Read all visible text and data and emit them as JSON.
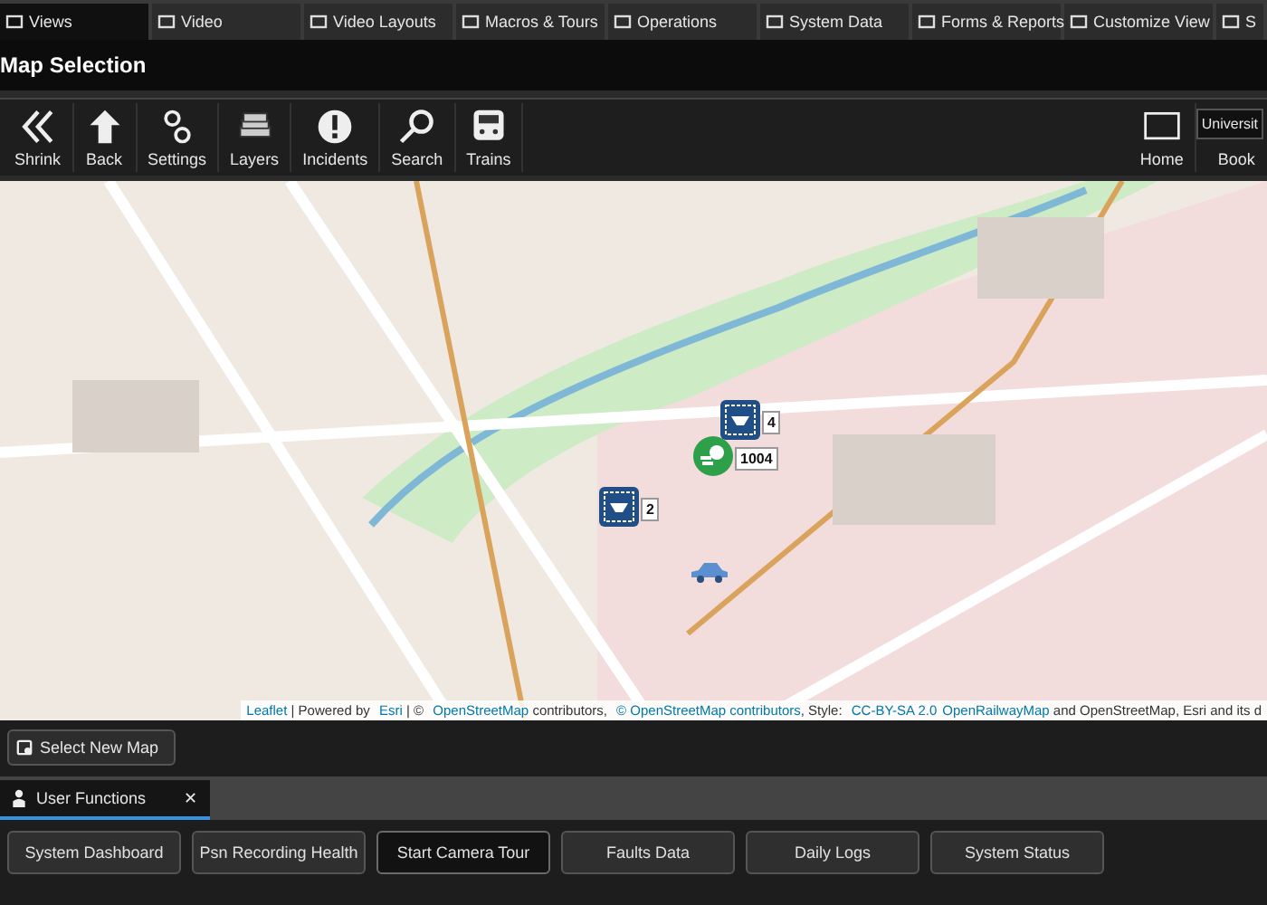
{
  "tabs": [
    {
      "label": "Views",
      "selected": true
    },
    {
      "label": "Video",
      "selected": false
    },
    {
      "label": "Video Layouts",
      "selected": false
    },
    {
      "label": "Macros & Tours",
      "selected": false
    },
    {
      "label": "Operations",
      "selected": false
    },
    {
      "label": "System Data",
      "selected": false
    },
    {
      "label": "Forms & Reports",
      "selected": false
    },
    {
      "label": "Customize View",
      "selected": false
    },
    {
      "label": "S",
      "selected": false
    }
  ],
  "title": "Map Selection",
  "toolbar": {
    "items": [
      "Shrink",
      "Back",
      "Settings",
      "Layers",
      "Incidents",
      "Search",
      "Trains"
    ],
    "home": "Home",
    "bookmark_field": {
      "value": "Universit"
    },
    "bookmark_label": "Book"
  },
  "map": {
    "markers": [
      {
        "kind": "camera",
        "label": "4"
      },
      {
        "kind": "group",
        "label": "1004"
      },
      {
        "kind": "camera",
        "label": "2"
      },
      {
        "kind": "vehicle"
      }
    ],
    "attribution": [
      {
        "kind": "link",
        "text": "Leaflet"
      },
      {
        "kind": "text",
        "text": " | Powered by "
      },
      {
        "kind": "link",
        "text": "Esri"
      },
      {
        "kind": "text",
        "text": " | © "
      },
      {
        "kind": "link",
        "text": "OpenStreetMap"
      },
      {
        "kind": "text",
        "text": " contributors, "
      },
      {
        "kind": "link",
        "text": "© OpenStreetMap contributors"
      },
      {
        "kind": "text",
        "text": ", Style: "
      },
      {
        "kind": "link",
        "text": "CC-BY-SA 2.0"
      },
      {
        "kind": "link",
        "text": "OpenRailwayMap"
      },
      {
        "kind": "text",
        "text": " and OpenStreetMap, Esri and its d"
      }
    ]
  },
  "select_map_button": "Select New Map",
  "panel_tab": {
    "label": "User Functions",
    "close": "✕"
  },
  "function_buttons": [
    {
      "label": "System Dashboard",
      "selected": false
    },
    {
      "label": "Psn Recording Health",
      "selected": false
    },
    {
      "label": "Start Camera Tour",
      "selected": true
    },
    {
      "label": "Faults Data",
      "selected": false
    },
    {
      "label": "Daily Logs",
      "selected": false
    },
    {
      "label": "System Status",
      "selected": false
    }
  ]
}
